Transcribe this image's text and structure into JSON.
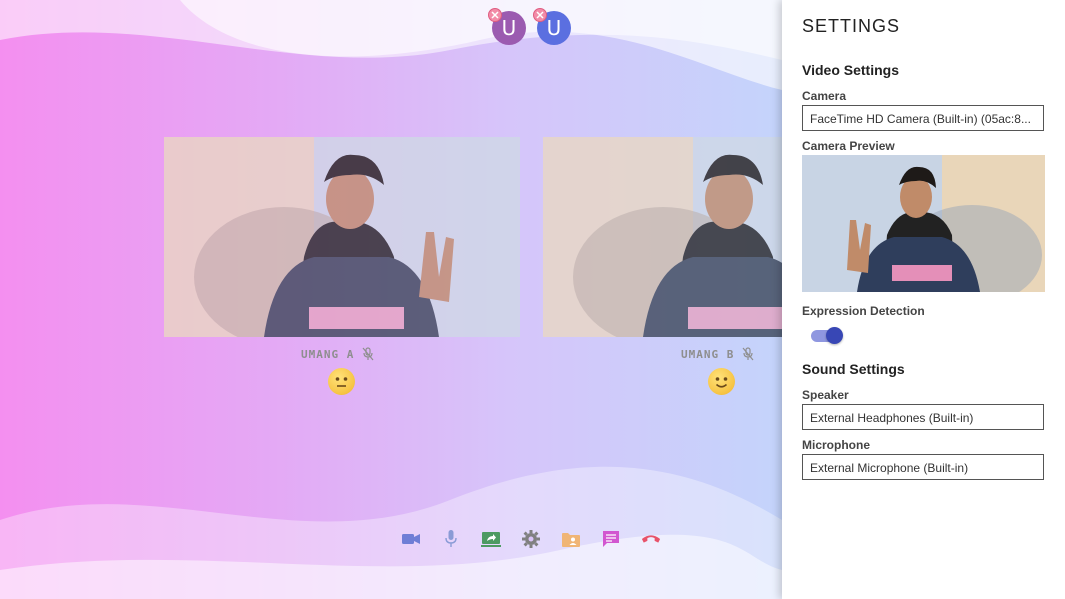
{
  "participants": [
    {
      "initial": "U",
      "color": "#9b5bb0"
    },
    {
      "initial": "U",
      "color": "#5b6fe0"
    }
  ],
  "videos": [
    {
      "name": "UMANG A",
      "expression": "neutral-face-emoji"
    },
    {
      "name": "UMANG B",
      "expression": "slightly-smiling-face-emoji"
    }
  ],
  "toolbar": {
    "icons": [
      "video-camera-icon",
      "microphone-icon",
      "screen-share-icon",
      "gear-icon",
      "contacts-folder-icon",
      "chat-icon",
      "hang-up-icon"
    ]
  },
  "settings": {
    "title": "SETTINGS",
    "video_section": "Video Settings",
    "camera_label": "Camera",
    "camera_value": "FaceTime HD Camera (Built-in) (05ac:8...",
    "preview_label": "Camera Preview",
    "expression_label": "Expression Detection",
    "expression_enabled": true,
    "sound_section": "Sound Settings",
    "speaker_label": "Speaker",
    "speaker_value": "External Headphones (Built-in)",
    "microphone_label": "Microphone",
    "microphone_value": "External Microphone (Built-in)"
  },
  "colors": {
    "accent": "#3847b5",
    "hang_up": "#e8536a"
  }
}
